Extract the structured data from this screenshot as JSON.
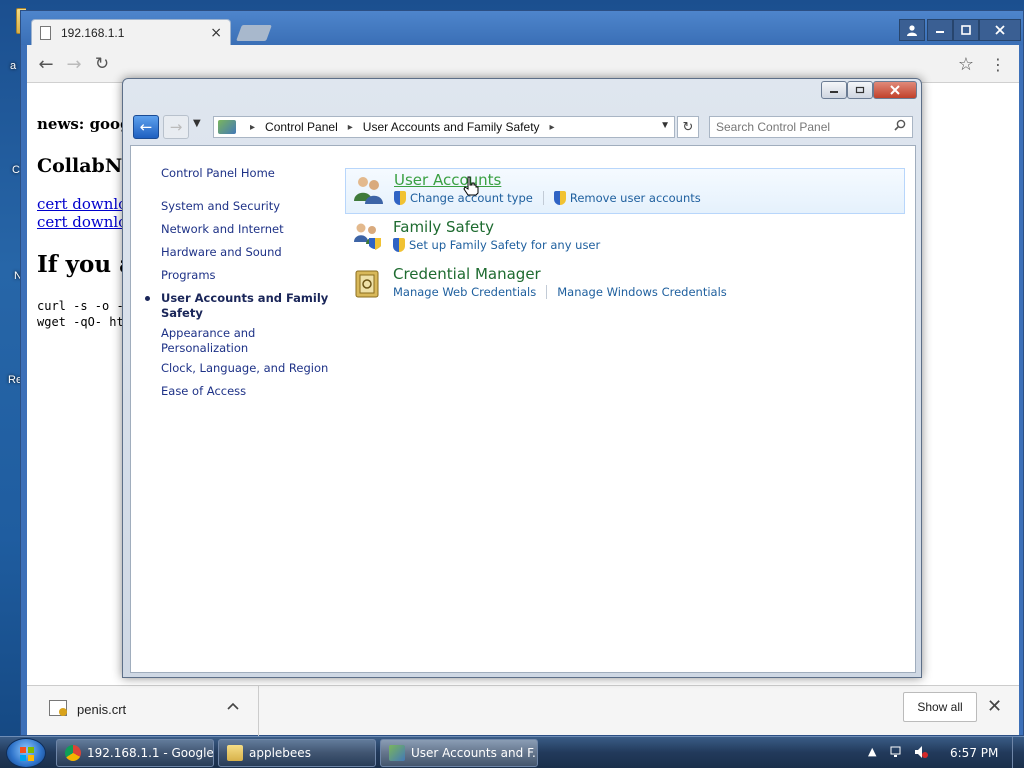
{
  "desktop": {
    "edge_letters": [
      "a",
      "C",
      "N",
      "Re"
    ]
  },
  "browser": {
    "tab_title": "192.168.1.1",
    "tab_close": "×",
    "back": "←",
    "forward": "→",
    "reload": "↻",
    "star": "☆",
    "menu": "⋮",
    "content": {
      "news": "news: google",
      "collabnet": "CollabNet",
      "link1": "cert download",
      "link2": "cert download",
      "heading": "If you ar",
      "cmd1": "curl -s -o -",
      "cmd2": "wget -qO- ht"
    },
    "download": {
      "filename": "penis.crt",
      "chevron": "^",
      "show_all": "Show all",
      "close": "✕"
    }
  },
  "control_panel": {
    "address": {
      "crumb1": "Control Panel",
      "crumb2": "User Accounts and Family Safety",
      "sep": "▸"
    },
    "search_placeholder": "Search Control Panel",
    "sidebar": [
      {
        "label": "Control Panel Home"
      },
      {
        "label": "System and Security"
      },
      {
        "label": "Network and Internet"
      },
      {
        "label": "Hardware and Sound"
      },
      {
        "label": "Programs"
      },
      {
        "label": "User Accounts and Family Safety"
      },
      {
        "label": "Appearance and Personalization"
      },
      {
        "label": "Clock, Language, and Region"
      },
      {
        "label": "Ease of Access"
      }
    ],
    "categories": [
      {
        "title": "User Accounts",
        "links": [
          "Change account type",
          "Remove user accounts"
        ],
        "icon": "user-accounts-icon"
      },
      {
        "title": "Family Safety",
        "links": [
          "Set up Family Safety for any user"
        ],
        "icon": "family-safety-icon"
      },
      {
        "title": "Credential Manager",
        "links": [
          "Manage Web Credentials",
          "Manage Windows Credentials"
        ],
        "icon": "credential-manager-icon"
      }
    ]
  },
  "taskbar": {
    "items": [
      {
        "label": "192.168.1.1 - Google ..."
      },
      {
        "label": "applebees"
      },
      {
        "label": "User Accounts and F..."
      }
    ],
    "clock": "6:57 PM"
  },
  "colors": {
    "cp_link": "#1e5f9e",
    "cp_title": "#1e6b30",
    "cp_title_hover": "#3aa042",
    "nav_text": "#1e3287"
  }
}
